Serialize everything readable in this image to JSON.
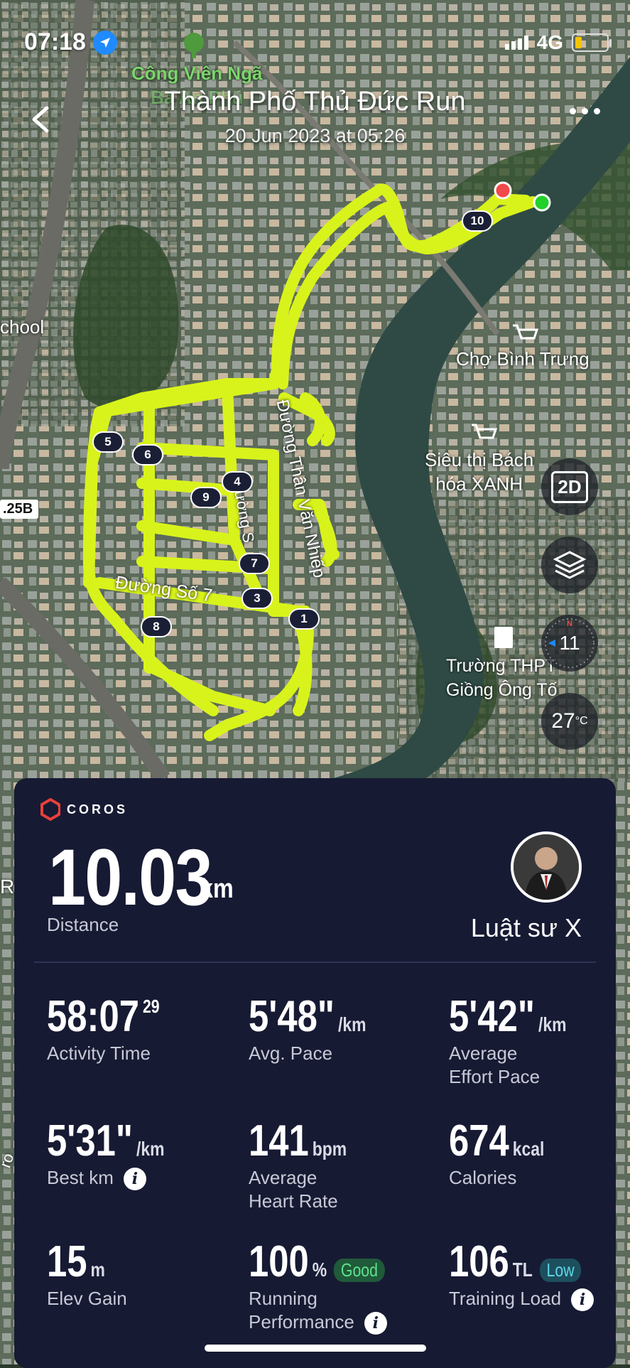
{
  "status": {
    "time": "07:18",
    "network": "4G"
  },
  "header": {
    "title": "Thành Phố Thủ Đức Run",
    "date": "20 Jun 2023 at 05:26"
  },
  "map_labels": {
    "park": "Công Viên Ngã",
    "park2": "Ba An Phú",
    "school_left": "chool",
    "market": "Chợ Bình Trưng",
    "supermarket_1": "Siêu thị Bách",
    "supermarket_2": "hóa XANH",
    "road_1": "Đường Thân Văn Nhiếp",
    "road_2": "Đường Số 7",
    "road_3": "ường S",
    "school_1": "Trường THPT",
    "school_2": "Giồng Ông Tố",
    "route_num": ".25B",
    "edge_r": "R",
    "edge_ro": "ro"
  },
  "markers": [
    "1",
    "3",
    "4",
    "5",
    "6",
    "7",
    "8",
    "9",
    "10"
  ],
  "map_controls": {
    "view_mode": "2D",
    "compass_value": "11",
    "temperature": "27",
    "temp_unit": "°C"
  },
  "panel": {
    "brand": "COROS",
    "distance": {
      "value": "10.03",
      "unit": "km",
      "label": "Distance"
    },
    "user_name": "Luật sư X",
    "metrics": [
      {
        "value": "58:07",
        "sup": "29",
        "label": "Activity Time"
      },
      {
        "value": "5'48\"",
        "unit": "/km",
        "label": "Avg. Pace"
      },
      {
        "value": "5'42\"",
        "unit": "/km",
        "label": "Average",
        "label2": "Effort Pace"
      },
      {
        "value": "5'31\"",
        "unit": "/km",
        "label": "Best km"
      },
      {
        "value": "141",
        "unit": "bpm",
        "label": "Average",
        "label2": "Heart Rate"
      },
      {
        "value": "674",
        "unit": "kcal",
        "label": "Calories"
      },
      {
        "value": "15",
        "unit": "m",
        "label": "Elev Gain"
      },
      {
        "value": "100",
        "unit": "%",
        "badge": "Good",
        "label": "Running",
        "label2": "Performance"
      },
      {
        "value": "106",
        "unit": "TL",
        "badge": "Low",
        "label": "Training Load"
      }
    ]
  },
  "colors": {
    "route": "#d8f31b",
    "panel": "#171a33",
    "good_badge": "#1f5a3a",
    "low_badge": "#1d4f5e",
    "start": "#22d12a",
    "end": "#f04a4a"
  }
}
